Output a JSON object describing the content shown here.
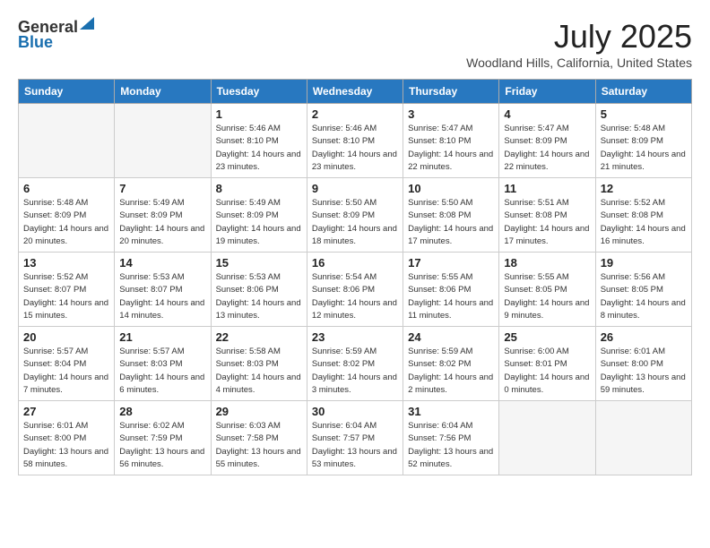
{
  "header": {
    "logo_general": "General",
    "logo_blue": "Blue",
    "month_title": "July 2025",
    "location": "Woodland Hills, California, United States"
  },
  "days_of_week": [
    "Sunday",
    "Monday",
    "Tuesday",
    "Wednesday",
    "Thursday",
    "Friday",
    "Saturday"
  ],
  "weeks": [
    [
      {
        "day": "",
        "empty": true
      },
      {
        "day": "",
        "empty": true
      },
      {
        "day": "1",
        "sunrise": "5:46 AM",
        "sunset": "8:10 PM",
        "daylight": "14 hours and 23 minutes."
      },
      {
        "day": "2",
        "sunrise": "5:46 AM",
        "sunset": "8:10 PM",
        "daylight": "14 hours and 23 minutes."
      },
      {
        "day": "3",
        "sunrise": "5:47 AM",
        "sunset": "8:10 PM",
        "daylight": "14 hours and 22 minutes."
      },
      {
        "day": "4",
        "sunrise": "5:47 AM",
        "sunset": "8:09 PM",
        "daylight": "14 hours and 22 minutes."
      },
      {
        "day": "5",
        "sunrise": "5:48 AM",
        "sunset": "8:09 PM",
        "daylight": "14 hours and 21 minutes."
      }
    ],
    [
      {
        "day": "6",
        "sunrise": "5:48 AM",
        "sunset": "8:09 PM",
        "daylight": "14 hours and 20 minutes."
      },
      {
        "day": "7",
        "sunrise": "5:49 AM",
        "sunset": "8:09 PM",
        "daylight": "14 hours and 20 minutes."
      },
      {
        "day": "8",
        "sunrise": "5:49 AM",
        "sunset": "8:09 PM",
        "daylight": "14 hours and 19 minutes."
      },
      {
        "day": "9",
        "sunrise": "5:50 AM",
        "sunset": "8:09 PM",
        "daylight": "14 hours and 18 minutes."
      },
      {
        "day": "10",
        "sunrise": "5:50 AM",
        "sunset": "8:08 PM",
        "daylight": "14 hours and 17 minutes."
      },
      {
        "day": "11",
        "sunrise": "5:51 AM",
        "sunset": "8:08 PM",
        "daylight": "14 hours and 17 minutes."
      },
      {
        "day": "12",
        "sunrise": "5:52 AM",
        "sunset": "8:08 PM",
        "daylight": "14 hours and 16 minutes."
      }
    ],
    [
      {
        "day": "13",
        "sunrise": "5:52 AM",
        "sunset": "8:07 PM",
        "daylight": "14 hours and 15 minutes."
      },
      {
        "day": "14",
        "sunrise": "5:53 AM",
        "sunset": "8:07 PM",
        "daylight": "14 hours and 14 minutes."
      },
      {
        "day": "15",
        "sunrise": "5:53 AM",
        "sunset": "8:06 PM",
        "daylight": "14 hours and 13 minutes."
      },
      {
        "day": "16",
        "sunrise": "5:54 AM",
        "sunset": "8:06 PM",
        "daylight": "14 hours and 12 minutes."
      },
      {
        "day": "17",
        "sunrise": "5:55 AM",
        "sunset": "8:06 PM",
        "daylight": "14 hours and 11 minutes."
      },
      {
        "day": "18",
        "sunrise": "5:55 AM",
        "sunset": "8:05 PM",
        "daylight": "14 hours and 9 minutes."
      },
      {
        "day": "19",
        "sunrise": "5:56 AM",
        "sunset": "8:05 PM",
        "daylight": "14 hours and 8 minutes."
      }
    ],
    [
      {
        "day": "20",
        "sunrise": "5:57 AM",
        "sunset": "8:04 PM",
        "daylight": "14 hours and 7 minutes."
      },
      {
        "day": "21",
        "sunrise": "5:57 AM",
        "sunset": "8:03 PM",
        "daylight": "14 hours and 6 minutes."
      },
      {
        "day": "22",
        "sunrise": "5:58 AM",
        "sunset": "8:03 PM",
        "daylight": "14 hours and 4 minutes."
      },
      {
        "day": "23",
        "sunrise": "5:59 AM",
        "sunset": "8:02 PM",
        "daylight": "14 hours and 3 minutes."
      },
      {
        "day": "24",
        "sunrise": "5:59 AM",
        "sunset": "8:02 PM",
        "daylight": "14 hours and 2 minutes."
      },
      {
        "day": "25",
        "sunrise": "6:00 AM",
        "sunset": "8:01 PM",
        "daylight": "14 hours and 0 minutes."
      },
      {
        "day": "26",
        "sunrise": "6:01 AM",
        "sunset": "8:00 PM",
        "daylight": "13 hours and 59 minutes."
      }
    ],
    [
      {
        "day": "27",
        "sunrise": "6:01 AM",
        "sunset": "8:00 PM",
        "daylight": "13 hours and 58 minutes."
      },
      {
        "day": "28",
        "sunrise": "6:02 AM",
        "sunset": "7:59 PM",
        "daylight": "13 hours and 56 minutes."
      },
      {
        "day": "29",
        "sunrise": "6:03 AM",
        "sunset": "7:58 PM",
        "daylight": "13 hours and 55 minutes."
      },
      {
        "day": "30",
        "sunrise": "6:04 AM",
        "sunset": "7:57 PM",
        "daylight": "13 hours and 53 minutes."
      },
      {
        "day": "31",
        "sunrise": "6:04 AM",
        "sunset": "7:56 PM",
        "daylight": "13 hours and 52 minutes."
      },
      {
        "day": "",
        "empty": true
      },
      {
        "day": "",
        "empty": true
      }
    ]
  ]
}
